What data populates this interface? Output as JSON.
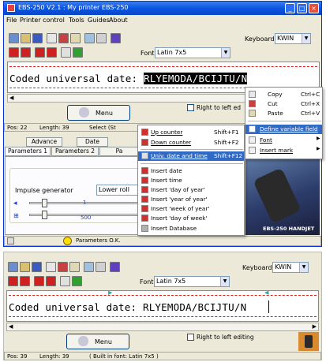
{
  "window": {
    "title": "EBS-250 V2.1 : My printer EBS-250",
    "title_buttons": [
      "_",
      "□",
      "×"
    ]
  },
  "menubar": [
    "File",
    "Printer control",
    "Tools",
    "Guides",
    "About"
  ],
  "toolbar": {
    "keyboard_label": "Keyboard",
    "keyboard_value": "KWIN",
    "font_label": "Font",
    "font_value": "Latin 7x5"
  },
  "editor_top": {
    "text_prefix": "Coded universal date: ",
    "text_selected": "RLYEMODA/BCIJTU/N"
  },
  "menu_button": "Menu",
  "right_to_left_top": "Right to left ed",
  "status_top": {
    "pos": "Pos: 22",
    "length": "Length: 39",
    "select": "Select (St"
  },
  "tabs_row1": [
    "Advance",
    "Date"
  ],
  "tabs_row2": [
    "Parameters 1",
    "Parameters 2",
    "Pa"
  ],
  "impulse": {
    "label": "Impulse generator",
    "value": "Lower roll",
    "slider1_value": "1",
    "slider2_value": "500"
  },
  "status_bottom": "Parameters O.K.",
  "left_submenu": {
    "counters": [
      {
        "label": "Up counter",
        "shortcut": "Shift+F1"
      },
      {
        "label": "Down counter",
        "shortcut": "Shift+F2"
      }
    ],
    "highlighted": {
      "label": "Univ. date and time",
      "shortcut": "Shift+F12"
    },
    "inserts": [
      "Insert date",
      "Insert time",
      "Insert 'day of year'",
      "Insert 'year of year'",
      "Insert 'week of year'",
      "Insert 'day of week'",
      "Insert Database"
    ]
  },
  "context_menu": {
    "edit": [
      {
        "label": "Copy",
        "shortcut": "Ctrl+C"
      },
      {
        "label": "Cut",
        "shortcut": "Ctrl+X"
      },
      {
        "label": "Paste",
        "shortcut": "Ctrl+V"
      }
    ],
    "highlighted": "Define variable field",
    "more": [
      "Font",
      "Insert mark"
    ]
  },
  "product_label": "EBS-250 HANDJET",
  "lower": {
    "keyboard_label": "Keyboard",
    "keyboard_value": "KWIN",
    "font_label": "Font",
    "font_value": "Latin 7x5",
    "editor_text": "Coded universal date: RLYEMODA/BCIJTU/N",
    "menu_button": "Menu",
    "right_to_left": "Right to left editing",
    "status": {
      "pos": "Pos: 39",
      "length": "Length: 39",
      "font": "( Built in font: Latin 7x5 )"
    }
  },
  "colors": {
    "title_blue": "#0a55e0",
    "highlight": "#316ac5",
    "menu_highlight": "#316ac5",
    "dash_red": "#d82020"
  }
}
